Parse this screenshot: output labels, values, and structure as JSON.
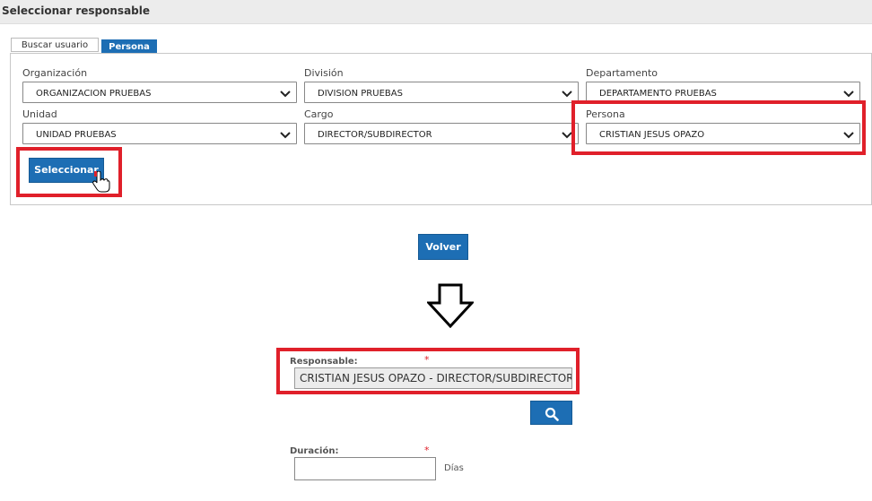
{
  "window": {
    "title": "Seleccionar responsable"
  },
  "tabs": [
    {
      "label": "Buscar usuario",
      "active": false
    },
    {
      "label": "Persona",
      "active": true
    }
  ],
  "form": {
    "organizacion": {
      "label": "Organización",
      "value": "ORGANIZACION PRUEBAS"
    },
    "division": {
      "label": "División",
      "value": "DIVISION PRUEBAS"
    },
    "departamento": {
      "label": "Departamento",
      "value": "DEPARTAMENTO PRUEBAS"
    },
    "unidad": {
      "label": "Unidad",
      "value": "UNIDAD PRUEBAS"
    },
    "cargo": {
      "label": "Cargo",
      "value": "DIRECTOR/SUBDIRECTOR"
    },
    "persona": {
      "label": "Persona",
      "value": "CRISTIAN JESUS OPAZO"
    },
    "select_button": "Seleccionar"
  },
  "back_button": "Volver",
  "responsable": {
    "label": "Responsable:",
    "required_mark": "*",
    "value": "CRISTIAN JESUS OPAZO - DIRECTOR/SUBDIRECTOR"
  },
  "duracion": {
    "label": "Duración:",
    "required_mark": "*",
    "value": "",
    "unit": "Días"
  },
  "colors": {
    "accent": "#1d6eb4",
    "highlight": "#e0202a"
  },
  "icons": [
    "chevron-down-icon",
    "hand-cursor-icon",
    "down-arrow-icon",
    "search-icon"
  ]
}
